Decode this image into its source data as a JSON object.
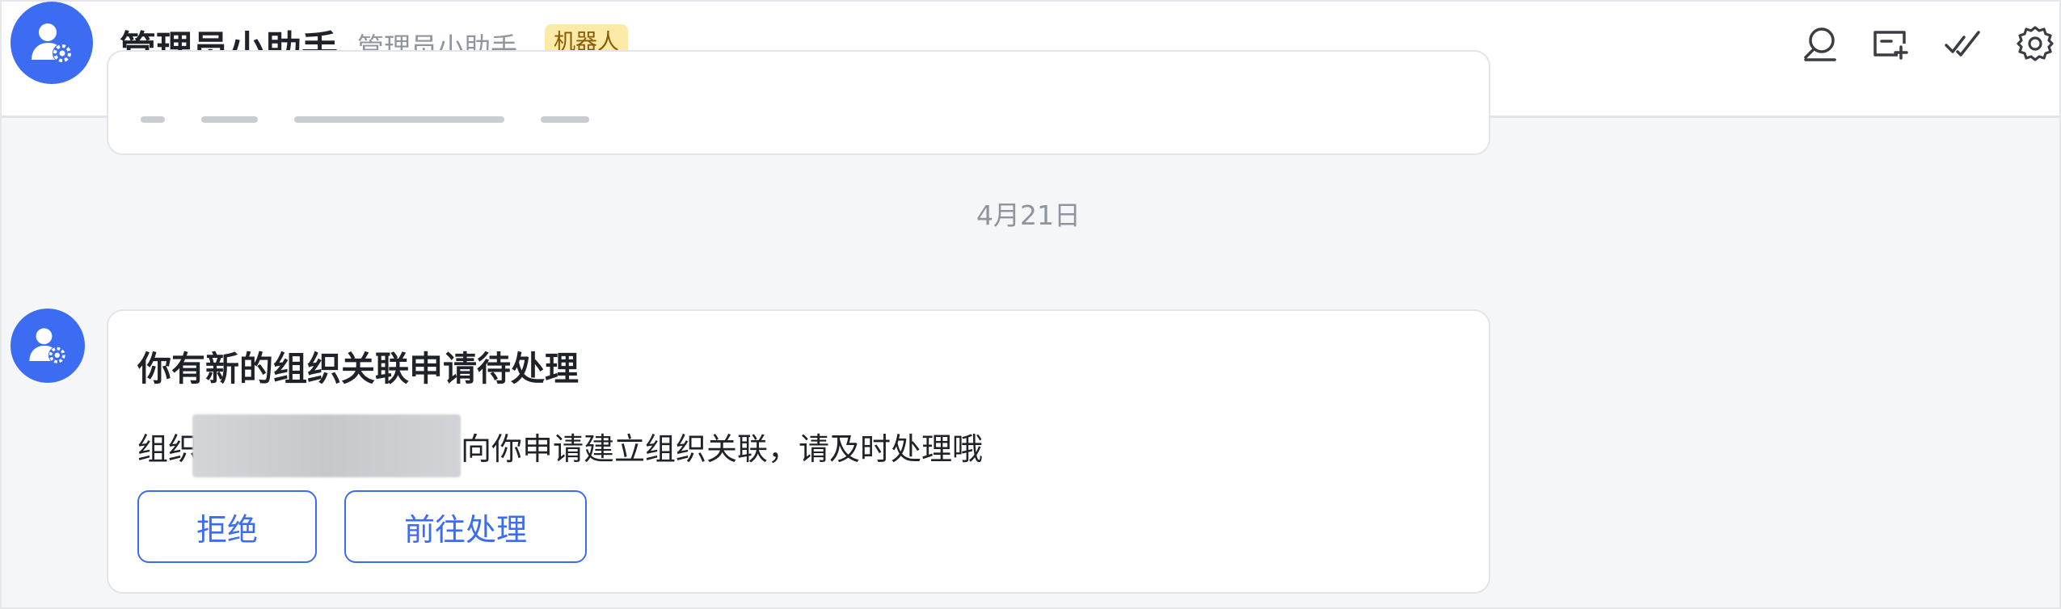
{
  "header": {
    "title": "管理员小助手",
    "subtitle": "管理员小助手",
    "badge": "机器人",
    "icons": [
      "search-icon",
      "add-tab-icon",
      "mark-done-icon",
      "settings-icon"
    ]
  },
  "timeline": {
    "date_separator": "4月21日"
  },
  "message": {
    "title": "你有新的组织关联申请待处理",
    "body_prefix": "组织",
    "body_suffix": "向你申请建立组织关联，请及时处理哦",
    "reject_label": "拒绝",
    "handle_label": "前往处理"
  },
  "colors": {
    "accent": "#3c6cf2",
    "badge_bg": "#fbeaa8",
    "badge_text": "#8a5a00",
    "background": "#f5f6f8"
  }
}
